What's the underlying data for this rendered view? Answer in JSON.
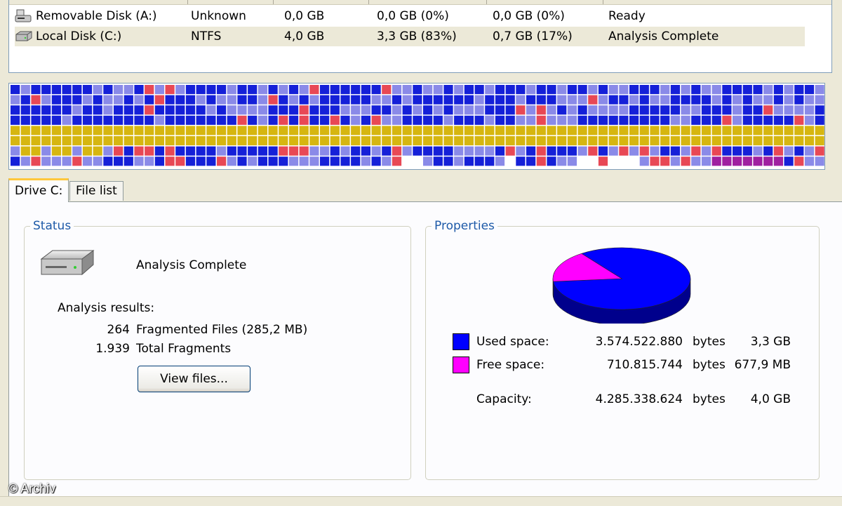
{
  "drives": [
    {
      "name": "Removable Disk (A:)",
      "fs": "Unknown",
      "capacity": "0,0 GB",
      "free": "0,0 GB (0%)",
      "pct_free": "0,0 GB (0%)",
      "status": "Ready",
      "icon": "floppy-drive-icon"
    },
    {
      "name": "Local Disk (C:)",
      "fs": "NTFS",
      "capacity": "4,0 GB",
      "free": "3,3 GB (83%)",
      "pct_free": "0,7 GB (17%)",
      "status": "Analysis Complete",
      "icon": "hard-disk-icon"
    }
  ],
  "cluster_map": {
    "colors": {
      "fragmented": "#e84855",
      "contiguous": "#1520d8",
      "unmovable": "#d6b610",
      "free": "#ffffff",
      "system": "#8a8ae8",
      "purple": "#a020a0"
    }
  },
  "tabs": {
    "drive": "Drive C:",
    "files": "File list"
  },
  "status": {
    "title": "Status",
    "message": "Analysis Complete",
    "results_label": "Analysis results:",
    "fragmented_files_count": "264",
    "fragmented_files_label": "Fragmented Files (285,2 MB)",
    "total_fragments_count": "1.939",
    "total_fragments_label": "Total Fragments",
    "view_files_button": "View files..."
  },
  "properties": {
    "title": "Properties",
    "used_label": "Used space:",
    "used_bytes": "3.574.522.880",
    "used_unit": "bytes",
    "used_human": "3,3 GB",
    "free_label": "Free space:",
    "free_bytes": "710.815.744",
    "free_unit": "bytes",
    "free_human": "677,9 MB",
    "capacity_label": "Capacity:",
    "capacity_bytes": "4.285.338.624",
    "capacity_unit": "bytes",
    "capacity_human": "4,0 GB",
    "used_color": "#0000ff",
    "free_color": "#ff00ff"
  },
  "chart_data": {
    "type": "pie",
    "categories": [
      "Used space",
      "Free space"
    ],
    "values": [
      3574522880,
      710815744
    ],
    "colors": [
      "#0000ff",
      "#ff00ff"
    ]
  },
  "watermark": "© Archiv"
}
